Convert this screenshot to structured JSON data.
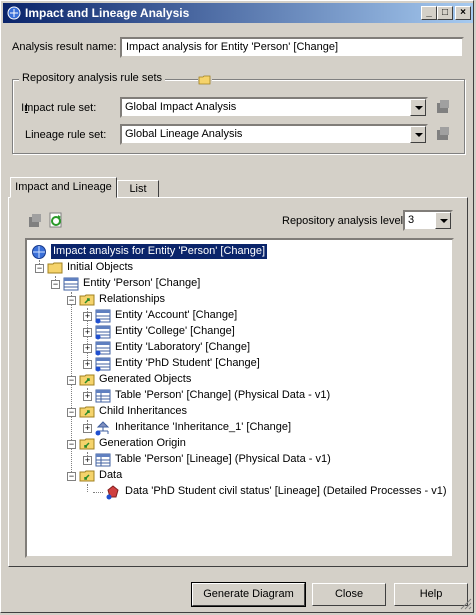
{
  "window": {
    "title": "Impact and Lineage Analysis"
  },
  "form": {
    "result_name_label": "Analysis result name:",
    "result_name_value": "Impact analysis for Entity 'Person' [Change]",
    "ruleset_group_label": "Repository analysis rule sets",
    "impact_label": "Impact rule set:",
    "impact_value": "Global Impact Analysis",
    "lineage_label": "Lineage rule set:",
    "lineage_value": "Global Lineage Analysis"
  },
  "tabs": [
    {
      "label": "Impact and Lineage"
    },
    {
      "label": "List"
    }
  ],
  "panel": {
    "level_label": "Repository analysis level:",
    "level_value": "3"
  },
  "tree": {
    "root": "Impact analysis for Entity 'Person' [Change]",
    "initial_objects": "Initial Objects",
    "entity_person": "Entity 'Person' [Change]",
    "relationships": "Relationships",
    "rel_items": [
      "Entity 'Account' [Change]",
      "Entity 'College' [Change]",
      "Entity 'Laboratory' [Change]",
      "Entity 'PhD Student' [Change]"
    ],
    "generated_objects": "Generated Objects",
    "gen_item": "Table 'Person' [Change] (Physical Data - v1)",
    "child_inheritances": "Child Inheritances",
    "inh_item": "Inheritance 'Inheritance_1' [Change]",
    "generation_origin": "Generation Origin",
    "origin_item": "Table 'Person' [Lineage] (Physical Data - v1)",
    "data": "Data",
    "data_item": "Data 'PhD Student civil status' [Lineage] (Detailed Processes - v1)"
  },
  "buttons": {
    "generate": "Generate Diagram",
    "close": "Close",
    "help": "Help"
  },
  "colors": {
    "title_start": "#0a246a",
    "title_end": "#a6caf0",
    "selection": "#0a246a"
  }
}
